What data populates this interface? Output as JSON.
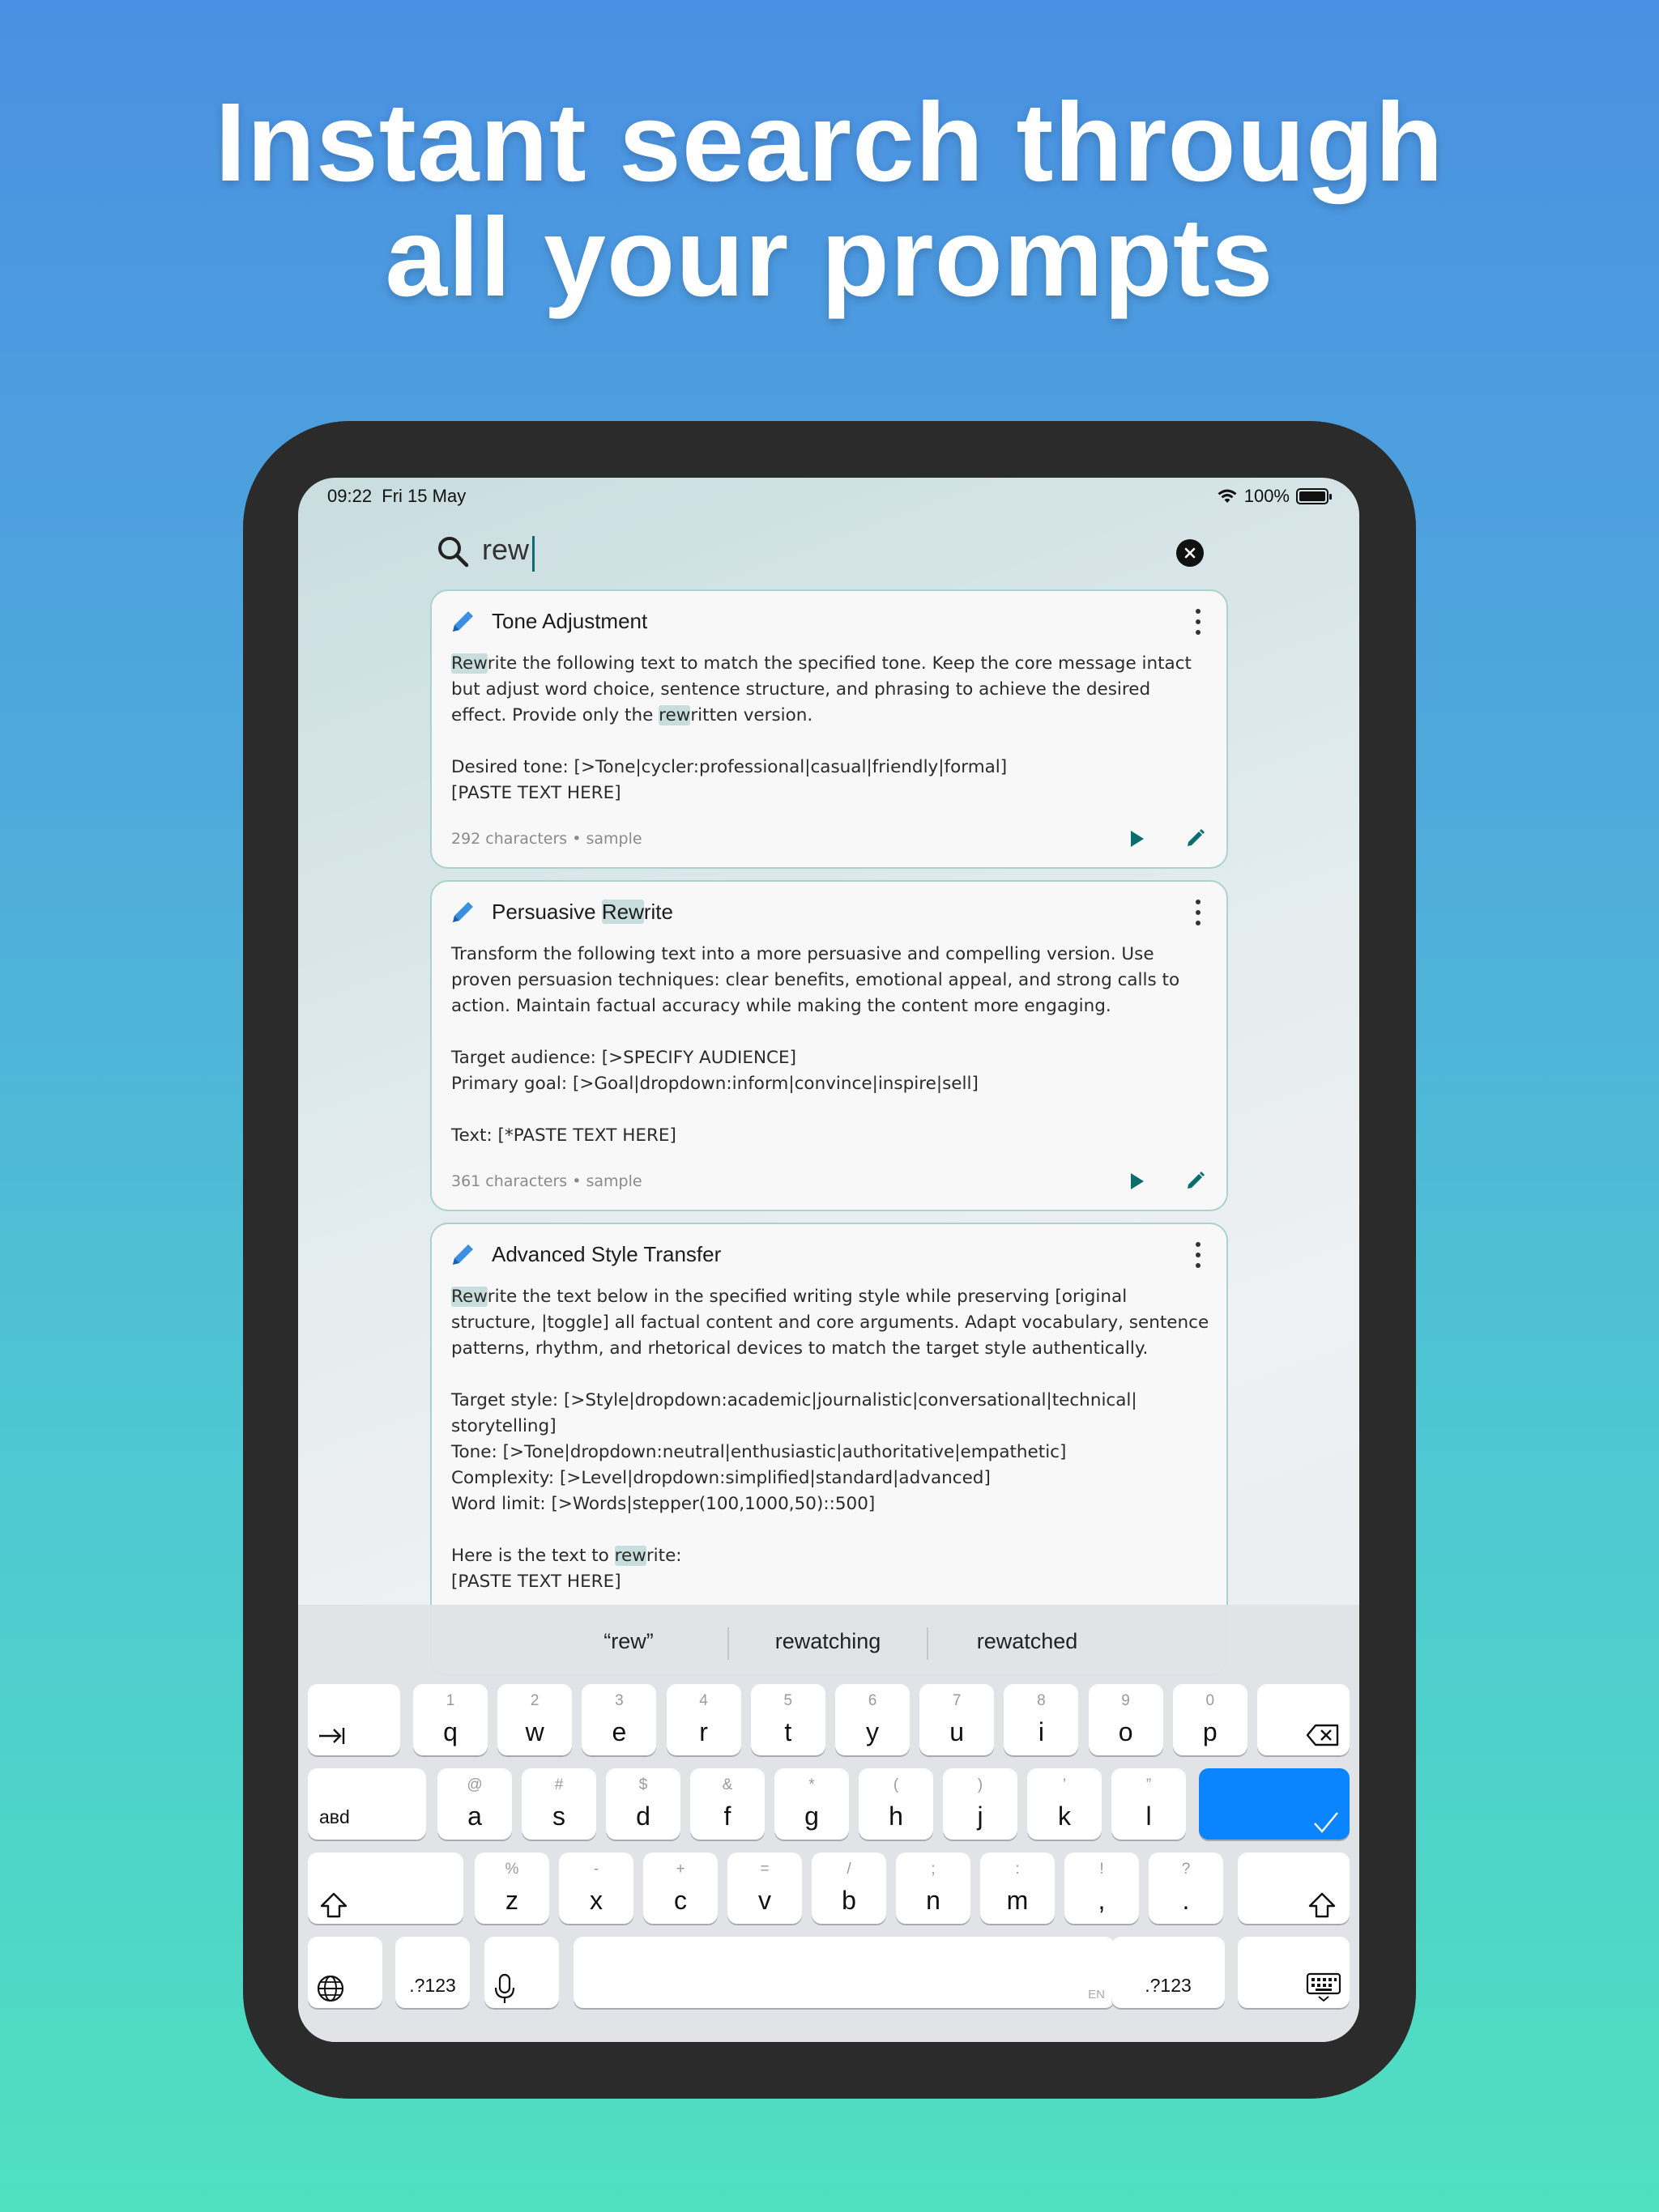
{
  "headline": {
    "line1": "Instant search through",
    "line2": "all your prompts"
  },
  "status": {
    "time": "09:22",
    "date": "Fri 15 May",
    "battery": "100%"
  },
  "search": {
    "query": "rew"
  },
  "cards": [
    {
      "title": "Tone Adjustment",
      "body_parts": {
        "p1_hl": "Rew",
        "p1_a": "rite the following text to match the specified tone. Keep the core message intact\nbut adjust word choice, sentence structure, and phrasing to achieve the desired\neffect. Provide only the ",
        "p1_hl2": "rew",
        "p1_b": "ritten version.\n\nDesired tone: [>Tone|cycler:professional|casual|friendly|formal]\n[PASTE TEXT HERE]"
      },
      "footer": "292 characters • sample"
    },
    {
      "title_a": "Persuasive ",
      "title_hl": "Rew",
      "title_b": "rite",
      "body": "Transform the following text into a more persuasive and compelling version. Use\nproven persuasion techniques: clear benefits, emotional appeal, and strong calls to\naction. Maintain factual accuracy while making the content more engaging.\n\nTarget audience: [>SPECIFY AUDIENCE]\nPrimary goal: [>Goal|dropdown:inform|convince|inspire|sell]\n\nText: [*PASTE TEXT HERE]",
      "footer": "361 characters • sample"
    },
    {
      "title": "Advanced Style Transfer",
      "body_parts": {
        "p1_hl": "Rew",
        "p1_a": "rite the text below in the specified writing style while preserving [original\nstructure, |toggle] all factual content and core arguments. Adapt vocabulary, sentence\npatterns, rhythm, and rhetorical devices to match the target style authentically.\n\nTarget style: [>Style|dropdown:academic|journalistic|conversational|technical|\nstorytelling]\nTone: [>Tone|dropdown:neutral|enthusiastic|authoritative|empathetic]\nComplexity: [>Level|dropdown:simplified|standard|advanced]\nWord limit: [>Words|stepper(100,1000,50)::500]\n\nHere is the text to ",
        "p1_hl2": "rew",
        "p1_b": "rite:\n[PASTE TEXT HERE]"
      }
    }
  ],
  "keyboard": {
    "predictions": [
      "“rew”",
      "rewatching",
      "rewatched"
    ],
    "row1": [
      {
        "sub": "1",
        "main": "q"
      },
      {
        "sub": "2",
        "main": "w"
      },
      {
        "sub": "3",
        "main": "e"
      },
      {
        "sub": "4",
        "main": "r"
      },
      {
        "sub": "5",
        "main": "t"
      },
      {
        "sub": "6",
        "main": "y"
      },
      {
        "sub": "7",
        "main": "u"
      },
      {
        "sub": "8",
        "main": "i"
      },
      {
        "sub": "9",
        "main": "o"
      },
      {
        "sub": "0",
        "main": "p"
      }
    ],
    "row2": [
      {
        "sub": "@",
        "main": "a"
      },
      {
        "sub": "#",
        "main": "s"
      },
      {
        "sub": "$",
        "main": "d"
      },
      {
        "sub": "&",
        "main": "f"
      },
      {
        "sub": "*",
        "main": "g"
      },
      {
        "sub": "(",
        "main": "h"
      },
      {
        "sub": ")",
        "main": "j"
      },
      {
        "sub": "’",
        "main": "k"
      },
      {
        "sub": "”",
        "main": "l"
      }
    ],
    "row3": [
      {
        "sub": "%",
        "main": "z"
      },
      {
        "sub": "-",
        "main": "x"
      },
      {
        "sub": "+",
        "main": "c"
      },
      {
        "sub": "=",
        "main": "v"
      },
      {
        "sub": "/",
        "main": "b"
      },
      {
        "sub": ";",
        "main": "n"
      },
      {
        "sub": ":",
        "main": "m"
      },
      {
        "sub": "!",
        "main": ","
      },
      {
        "sub": "?",
        "main": "."
      }
    ],
    "caps_label": "aвd",
    "numbers_label": ".?123",
    "space_hint": "EN"
  }
}
